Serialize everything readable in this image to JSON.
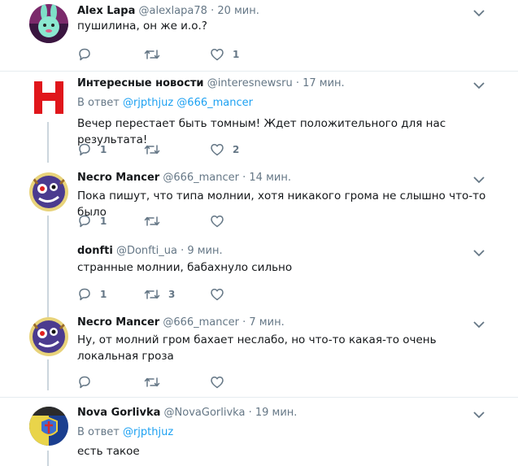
{
  "tweets": [
    {
      "name": "Alex Lapa",
      "handle": "@alexlapa78",
      "time": "· 20 мин.",
      "text": "пушилина, он же и.о.?",
      "replies": "",
      "retweets": "",
      "likes": "1"
    },
    {
      "name": "Интересные новости",
      "handle": "@interesnewsru",
      "time": "· 17 мин.",
      "reply_prefix": "В ответ ",
      "reply_mentions": "@rjpthjuz @666_mancer",
      "text": "Вечер перестает быть томным! Ждет положительного для нас результата!",
      "replies": "1",
      "retweets": "",
      "likes": "2"
    },
    {
      "name": "Necro Mancer",
      "handle": "@666_mancer",
      "time": "· 14 мин.",
      "text": "Пока пишут, что типа молнии, хотя никакого грома не слышно что-то было",
      "replies": "1",
      "retweets": "",
      "likes": ""
    },
    {
      "name": "donfti",
      "handle": "@Donfti_ua",
      "time": "· 9 мин.",
      "text": "странные молнии, бабахнуло сильно",
      "replies": "1",
      "retweets": "3",
      "likes": ""
    },
    {
      "name": "Necro Mancer",
      "handle": "@666_mancer",
      "time": "· 7 мин.",
      "text": "Ну, от молний гром бахает неслабо, но что-то какая-то очень локальная гроза",
      "replies": "",
      "retweets": "",
      "likes": ""
    },
    {
      "name": "Nova Gorlivka",
      "handle": "@NovaGorlivka",
      "time": "· 19 мин.",
      "reply_prefix": "В ответ ",
      "reply_mentions": "@rjpthjuz",
      "text": "есть такое"
    }
  ],
  "colors": {
    "accent": "#1da1f2",
    "secondary_text": "#657786",
    "divider": "#e6ecf0",
    "thread_line": "#ccd6dd"
  },
  "icons": [
    "reply-icon",
    "retweet-icon",
    "like-icon",
    "chevron-down-icon"
  ]
}
